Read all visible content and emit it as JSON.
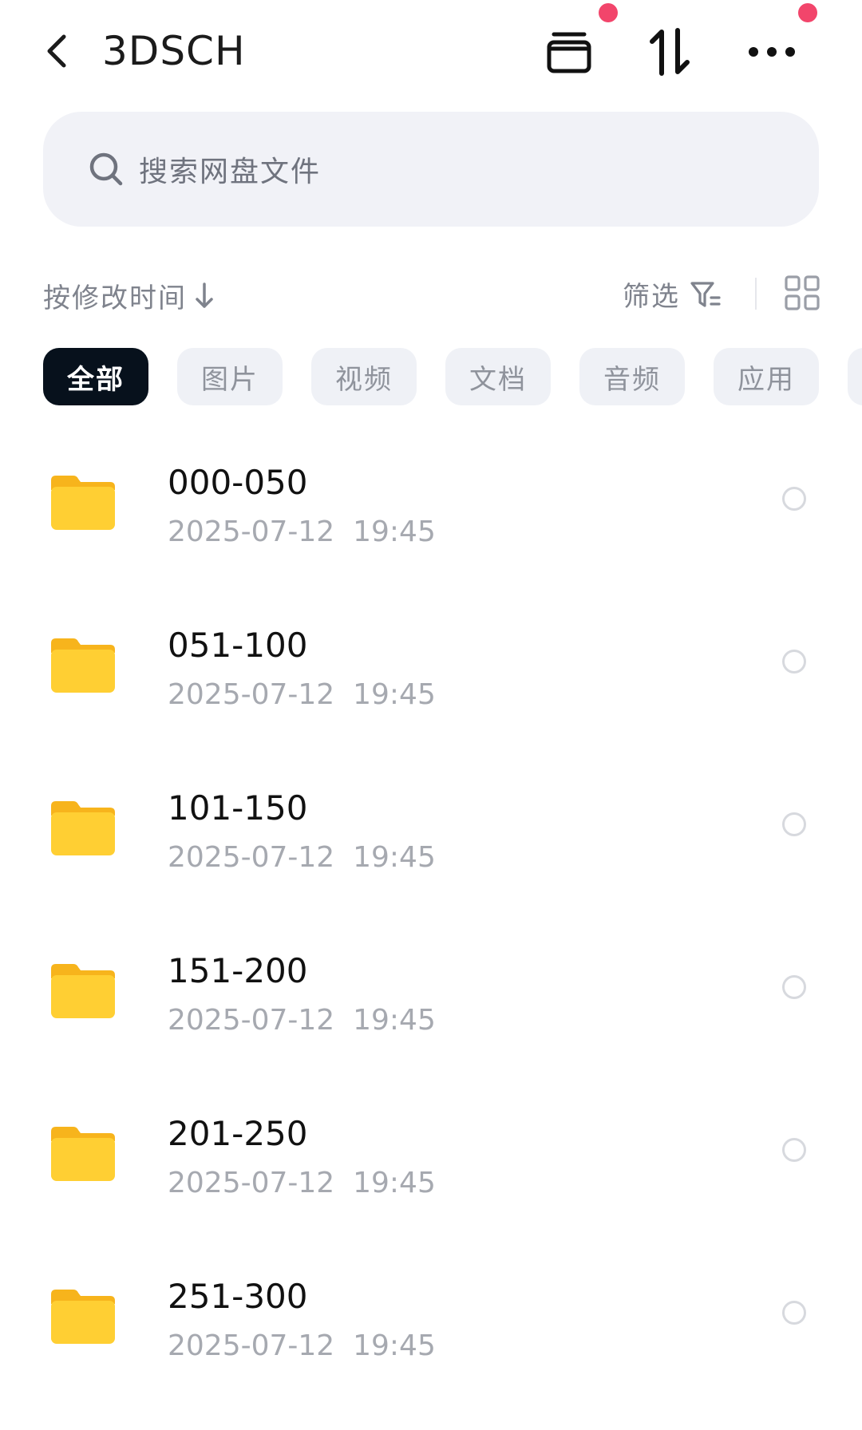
{
  "header": {
    "title": "3DSCH",
    "back_icon": "chevron-left-icon",
    "archive_icon": "archive-box-icon",
    "sort_toggle_icon": "sort-up-down-icon",
    "more_icon": "more-horizontal-icon",
    "notification_dot_color": "#f2456b"
  },
  "search": {
    "placeholder": "搜索网盘文件",
    "background": "#f1f2f7"
  },
  "sort_bar": {
    "sort_label": "按修改时间",
    "sort_direction_icon": "arrow-down-icon",
    "filter_label": "筛选",
    "filter_icon": "filter-icon",
    "view_toggle_icon": "grid-view-icon"
  },
  "categories": [
    {
      "label": "全部",
      "active": true
    },
    {
      "label": "图片",
      "active": false
    },
    {
      "label": "视频",
      "active": false
    },
    {
      "label": "文档",
      "active": false
    },
    {
      "label": "音频",
      "active": false
    },
    {
      "label": "应用",
      "active": false
    }
  ],
  "files": [
    {
      "name": "000-050",
      "modified": "2025-07-12  19:45",
      "type_icon": "folder-icon"
    },
    {
      "name": "051-100",
      "modified": "2025-07-12  19:45",
      "type_icon": "folder-icon"
    },
    {
      "name": "101-150",
      "modified": "2025-07-12  19:45",
      "type_icon": "folder-icon"
    },
    {
      "name": "151-200",
      "modified": "2025-07-12  19:45",
      "type_icon": "folder-icon"
    },
    {
      "name": "201-250",
      "modified": "2025-07-12  19:45",
      "type_icon": "folder-icon"
    },
    {
      "name": "251-300",
      "modified": "2025-07-12  19:45",
      "type_icon": "folder-icon"
    }
  ],
  "colors": {
    "folder": "#ffcf33",
    "folder_dark": "#f7b41c",
    "chip_active": "#07111c",
    "muted_text": "#a6a9b0"
  }
}
